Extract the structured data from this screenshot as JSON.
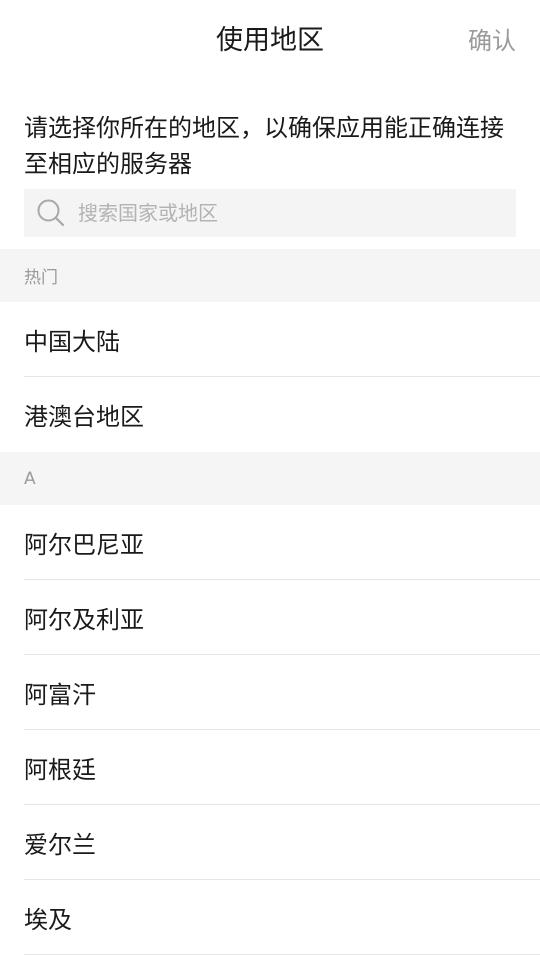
{
  "header": {
    "title": "使用地区",
    "confirm_label": "确认"
  },
  "description": "请选择你所在的地区，以确保应用能正确连接至相应的服务器",
  "search": {
    "placeholder": "搜索国家或地区",
    "value": ""
  },
  "sections": [
    {
      "title": "热门",
      "items": [
        "中国大陆",
        "港澳台地区"
      ]
    },
    {
      "title": "A",
      "items": [
        "阿尔巴尼亚",
        "阿尔及利亚",
        "阿富汗",
        "阿根廷",
        "爱尔兰",
        "埃及"
      ]
    }
  ]
}
